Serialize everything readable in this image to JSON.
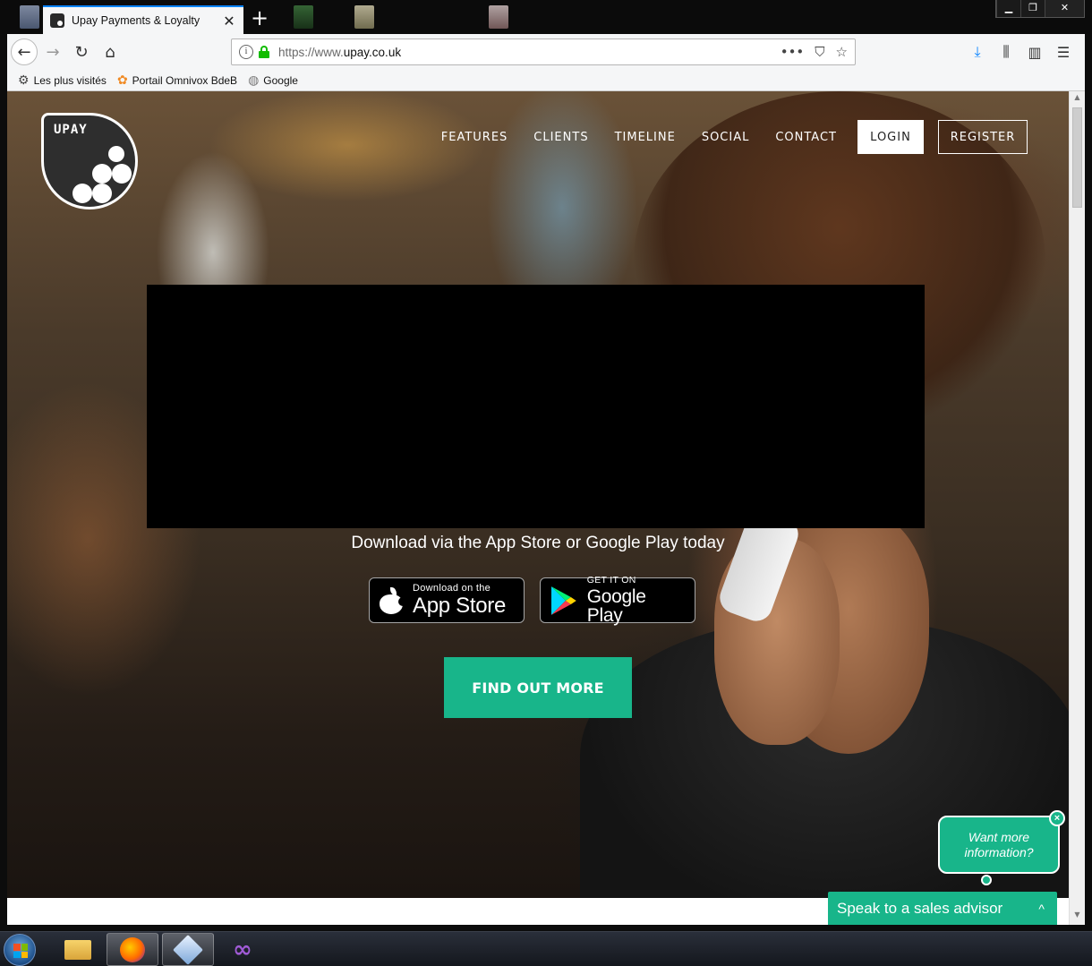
{
  "browser": {
    "tab_title": "Upay Payments & Loyalty",
    "tab_close": "✕",
    "new_tab": "+",
    "url_prefix": "https://www.",
    "url_domain": "upay.co.uk",
    "url_actions": "•••",
    "window_controls": [
      "▁",
      "❐",
      "✕"
    ],
    "bookmarks": [
      {
        "label": "Les plus visités",
        "icon": "gear-icon"
      },
      {
        "label": "Portail Omnivox BdeB",
        "icon": "flower-icon"
      },
      {
        "label": "Google",
        "icon": "globe-icon"
      }
    ]
  },
  "site": {
    "logo_text": "UPAY",
    "nav": {
      "features": "FEATURES",
      "clients": "CLIENTS",
      "timeline": "TIMELINE",
      "social": "SOCIAL",
      "contact": "CONTACT",
      "login": "LOGIN",
      "register": "REGISTER"
    },
    "tagline": "Download via the App Store or Google Play today",
    "app_store": {
      "small": "Download on the",
      "big": "App Store"
    },
    "google_play": {
      "small": "GET IT ON",
      "big": "Google Play"
    },
    "cta": "FIND OUT MORE"
  },
  "chat": {
    "bubble_line1": "Want more",
    "bubble_line2": "information?",
    "bubble_close": "×",
    "bar_label": "Speak to a sales advisor",
    "bar_chevron": "^"
  },
  "colors": {
    "accent": "#18b58a",
    "tab_highlight": "#0a84ff",
    "secure_lock": "#12bc00"
  }
}
